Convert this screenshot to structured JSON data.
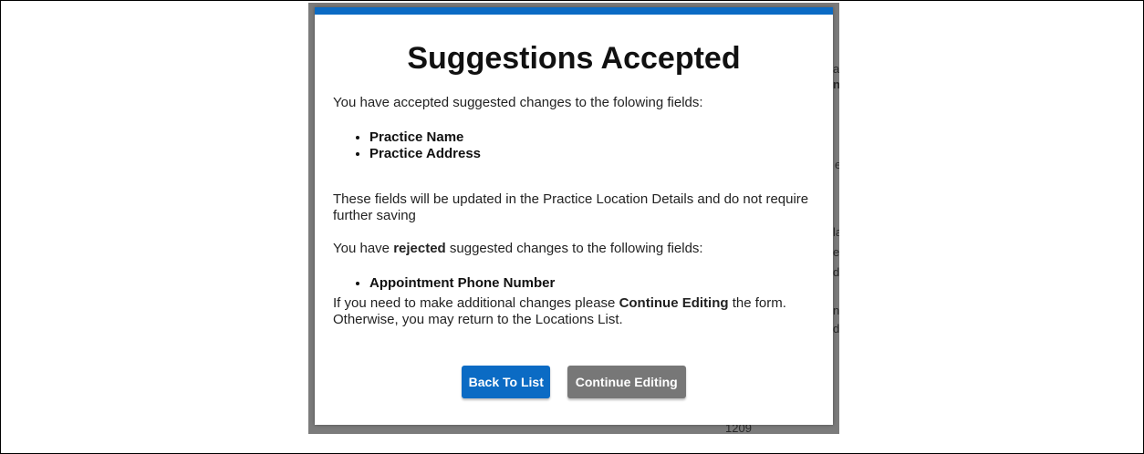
{
  "modal": {
    "title": "Suggestions Accepted",
    "accepted_intro": "You have accepted suggested changes to the folowing fields:",
    "accepted_fields": [
      "Practice Name",
      "Practice Address"
    ],
    "update_note": "These fields will be updated in the Practice Location Details and do not require further saving",
    "rejected_intro_pre": "You have ",
    "rejected_word": "rejected",
    "rejected_intro_post": " suggested changes to the following fields:",
    "rejected_fields": [
      "Appointment Phone Number"
    ],
    "closing_pre": "If you need to make additional changes please ",
    "closing_bold": "Continue Editing",
    "closing_post": " the form. Otherwise, you may return to the Locations List.",
    "back_button_label": "Back To List",
    "continue_button_label": "Continue Editing"
  },
  "background": {
    "fragments": [
      "ar",
      "ne",
      "e",
      "la",
      "ec",
      "d",
      "ni",
      "di",
      "1209"
    ]
  },
  "colors": {
    "accent": "#0b6bc4",
    "secondary_button": "#777777",
    "overlay": "#7b7b7b"
  }
}
